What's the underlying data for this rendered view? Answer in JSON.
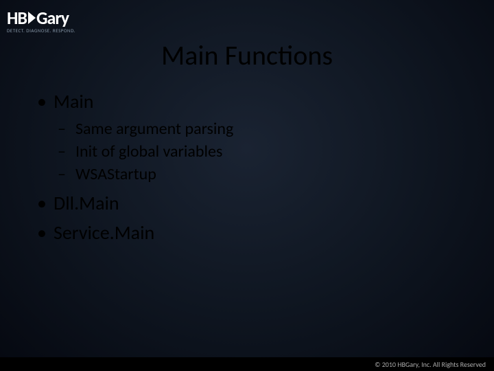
{
  "logo": {
    "hb": "HB",
    "gary": "Gary",
    "tagline": "DETECT. DIAGNOSE. RESPOND."
  },
  "slide": {
    "title": "Main Functions",
    "bullets": [
      {
        "text": "Main",
        "sub": [
          "Same argument parsing",
          "Init of global variables",
          "WSAStartup"
        ]
      },
      {
        "text": "Dll.Main",
        "sub": []
      },
      {
        "text": "Service.Main",
        "sub": []
      }
    ]
  },
  "footer": {
    "copyright": "© 2010 HBGary, Inc. All Rights Reserved"
  }
}
